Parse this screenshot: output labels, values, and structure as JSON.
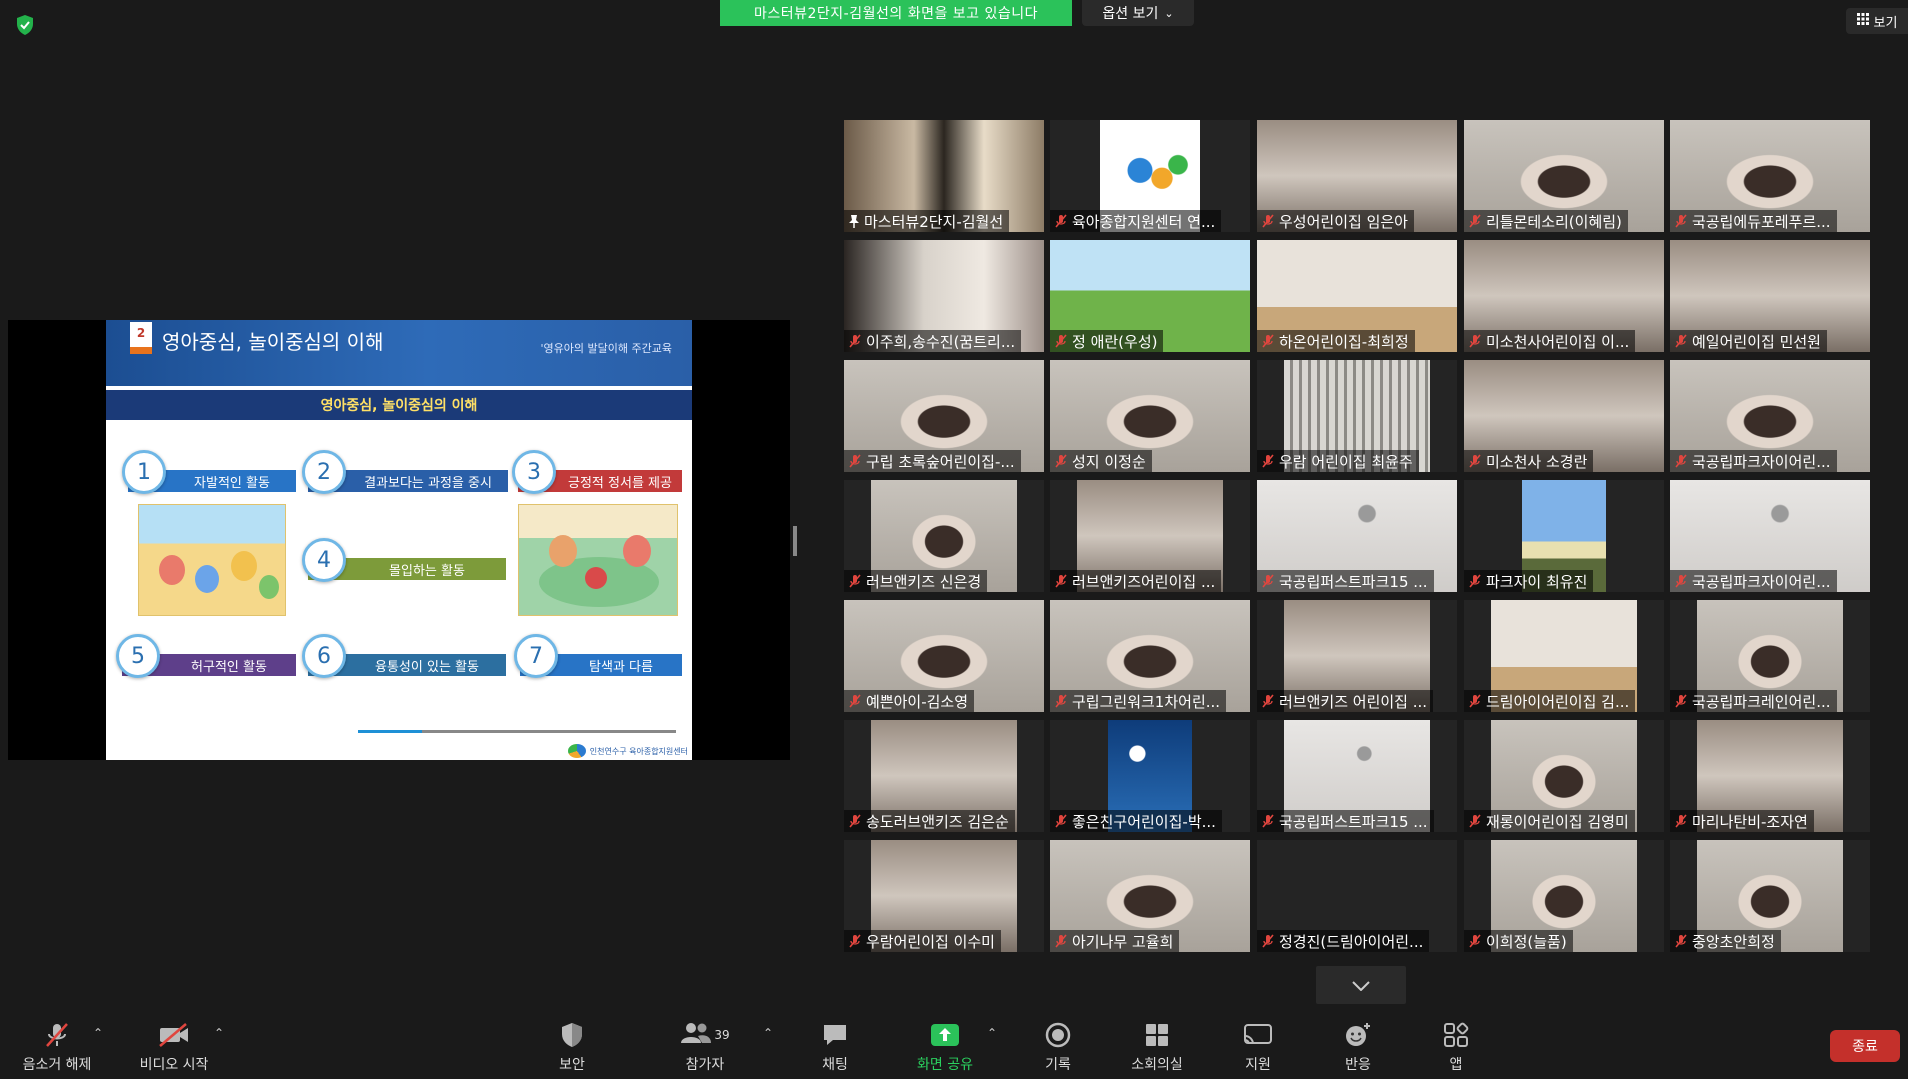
{
  "top": {
    "share_banner": "마스터뷰2단지-김월선의 화면을 보고 있습니다",
    "options_label": "옵션 보기",
    "view_label": "보기"
  },
  "slide": {
    "number": "2",
    "title": "영아중심, 놀이중심의 이해",
    "subtitle": "'영유아의 발달이해 주간교육",
    "band": "영아중심, 놀이중심의 이해",
    "items": [
      {
        "num": "1",
        "label": "자발적인 활동"
      },
      {
        "num": "2",
        "label": "결과보다는 과정을 중시"
      },
      {
        "num": "3",
        "label": "긍정적 정서를 제공"
      },
      {
        "num": "4",
        "label": "몰입하는 활동"
      },
      {
        "num": "5",
        "label": "허구적인 활동"
      },
      {
        "num": "6",
        "label": "융통성이 있는 활동"
      },
      {
        "num": "7",
        "label": "탐색과 다름"
      }
    ],
    "footer": "인천연수구 육아종합지원센터"
  },
  "participants": [
    {
      "name": "마스터뷰2단지-김월선",
      "muted": false,
      "active": true,
      "video": "teacher"
    },
    {
      "name": "육아종합지원센터 연...",
      "muted": true,
      "video": "logo"
    },
    {
      "name": "우성어린이집 임은아",
      "muted": true,
      "video": "room"
    },
    {
      "name": "리틀몬테소리(이혜림)",
      "muted": true,
      "video": "person"
    },
    {
      "name": "국공립에듀포레푸르...",
      "muted": true,
      "video": "person"
    },
    {
      "name": "이주희,송수진(꿈트리...",
      "muted": true,
      "video": "dark"
    },
    {
      "name": "정 애란(우성)",
      "muted": true,
      "video": "green"
    },
    {
      "name": "하온어린이집-최희정",
      "muted": true,
      "video": "wall"
    },
    {
      "name": "미소천사어린이집 이...",
      "muted": true,
      "video": "room"
    },
    {
      "name": "예일어린이집 민선원",
      "muted": true,
      "video": "room"
    },
    {
      "name": "구립 초록숲어린이집-...",
      "muted": true,
      "video": "person"
    },
    {
      "name": "성지 이정순",
      "muted": true,
      "video": "person"
    },
    {
      "name": "우람 어린이집 최윤주",
      "muted": true,
      "video": "building"
    },
    {
      "name": "미소천사 소경란",
      "muted": true,
      "video": "room"
    },
    {
      "name": "국공립파크자이어린...",
      "muted": true,
      "video": "person"
    },
    {
      "name": "러브앤키즈 신은경",
      "muted": true,
      "video": "person"
    },
    {
      "name": "러브앤키즈어린이집 ...",
      "muted": true,
      "video": "room"
    },
    {
      "name": "국공립퍼스트파크15 ...",
      "muted": true,
      "video": "ceiling"
    },
    {
      "name": "파크자이  최유진",
      "muted": true,
      "video": "sky"
    },
    {
      "name": "국공립파크자이어린...",
      "muted": true,
      "video": "ceiling"
    },
    {
      "name": "예쁜아이-김소영",
      "muted": true,
      "video": "person"
    },
    {
      "name": "구립그린워크1차어린...",
      "muted": true,
      "video": "person"
    },
    {
      "name": "러브앤키즈 어린이집 ...",
      "muted": true,
      "video": "room"
    },
    {
      "name": "드림아이어린이집 김...",
      "muted": true,
      "video": "wall"
    },
    {
      "name": "국공립파크레인어린...",
      "muted": true,
      "video": "person"
    },
    {
      "name": "송도러브앤키즈 김은순",
      "muted": true,
      "video": "room"
    },
    {
      "name": "좋은친구어린이집-박...",
      "muted": true,
      "video": "night"
    },
    {
      "name": "국공립퍼스트파크15 ...",
      "muted": true,
      "video": "ceiling"
    },
    {
      "name": "재롱이어린이집 김영미",
      "muted": true,
      "video": "person"
    },
    {
      "name": "마리나탄비-조자연",
      "muted": true,
      "video": "room"
    },
    {
      "name": "우람어린이집 이수미",
      "muted": true,
      "video": "room"
    },
    {
      "name": "아기나무 고율희",
      "muted": true,
      "video": "person"
    },
    {
      "name": "정경진(드림아이어린...",
      "muted": true,
      "video": "none"
    },
    {
      "name": "이희정(늘품)",
      "muted": true,
      "video": "person"
    },
    {
      "name": "중앙초안희정",
      "muted": true,
      "video": "person"
    }
  ],
  "toolbar": {
    "unmute": "음소거 해제",
    "start_video": "비디오 시작",
    "security": "보안",
    "participants": "참가자",
    "participants_count": "39",
    "chat": "채팅",
    "share_screen": "화면 공유",
    "record": "기록",
    "breakout": "소회의실",
    "support": "지원",
    "reactions": "반응",
    "apps": "앱",
    "end": "종료"
  },
  "colors": {
    "share_banner": "#2bc25a",
    "end_button": "#c4302b",
    "active_speaker": "#d9e04a",
    "mic_off": "#e0463f"
  }
}
